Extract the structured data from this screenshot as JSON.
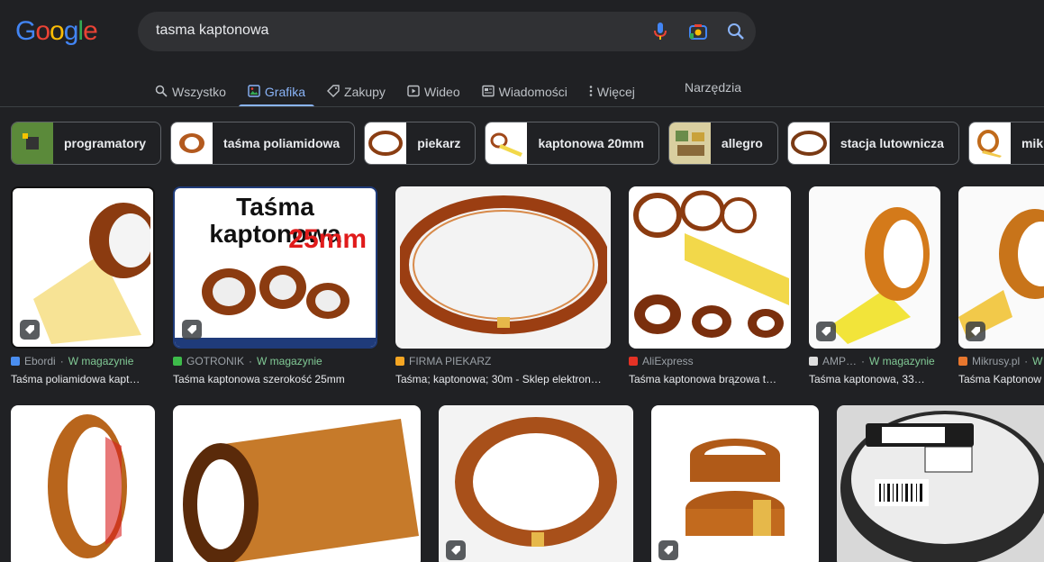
{
  "logo": "Google",
  "search": {
    "query": "tasma kaptonowa"
  },
  "tabs": [
    {
      "label": "Wszystko",
      "icon": "search-icon",
      "active": false
    },
    {
      "label": "Grafika",
      "icon": "image-icon",
      "active": true
    },
    {
      "label": "Zakupy",
      "icon": "tag-icon",
      "active": false
    },
    {
      "label": "Wideo",
      "icon": "play-icon",
      "active": false
    },
    {
      "label": "Wiadomości",
      "icon": "news-icon",
      "active": false
    },
    {
      "label": "Więcej",
      "icon": "more-vert-icon",
      "active": false
    }
  ],
  "tools_label": "Narzędzia",
  "chips": [
    "programatory",
    "taśma poliamidowa",
    "piekarz",
    "kaptonowa 20mm",
    "allegro",
    "stacja lutownicza",
    "mikrusy"
  ],
  "row1": [
    {
      "source": "Ebordi",
      "stock": "W magazynie",
      "title": "Taśma poliamidowa kapt…",
      "favcolor": "#4a8ef0"
    },
    {
      "source": "GOTRONIK",
      "stock": "W magazynie",
      "title": "Taśma kaptonowa szerokość 25mm",
      "favcolor": "#3dbb4a",
      "overlay1": "Taśma kaptonowa",
      "overlay2": "25mm"
    },
    {
      "source": "FIRMA PIEKARZ",
      "stock": "",
      "title": "Taśma; kaptonowa; 30m - Sklep elektron…",
      "favcolor": "#f5a623"
    },
    {
      "source": "AliExpress",
      "stock": "",
      "title": "Taśma kaptonowa brązowa t…",
      "favcolor": "#e43225"
    },
    {
      "source": "AMP…",
      "stock": "W magazynie",
      "title": "Taśma kaptonowa, 33…",
      "favcolor": "#dddddd"
    },
    {
      "source": "Mikrusy.pl",
      "stock": "W",
      "title": "Taśma Kaptonow",
      "favcolor": "#e8772e"
    }
  ],
  "row2_badges": [
    false,
    false,
    true,
    true,
    false
  ]
}
